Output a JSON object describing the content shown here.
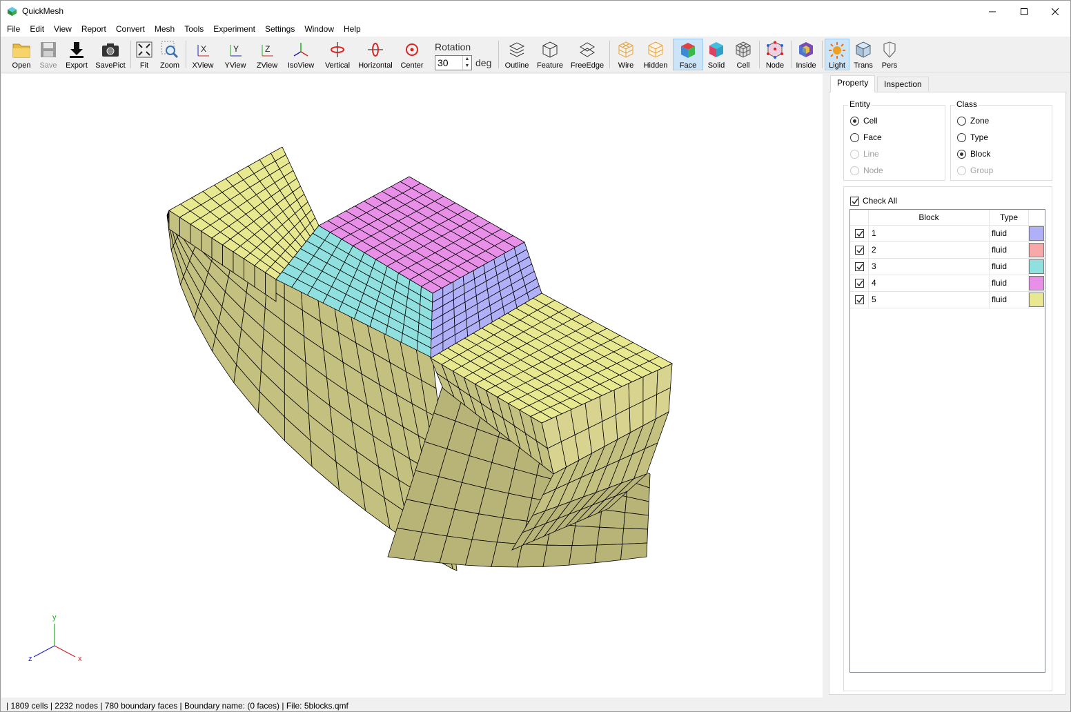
{
  "app": {
    "title": "QuickMesh"
  },
  "menu": [
    "File",
    "Edit",
    "View",
    "Report",
    "Convert",
    "Mesh",
    "Tools",
    "Experiment",
    "Settings",
    "Window",
    "Help"
  ],
  "toolbar": {
    "open": "Open",
    "save": "Save",
    "export": "Export",
    "savepict": "SavePict",
    "fit": "Fit",
    "zoom": "Zoom",
    "xview": "XView",
    "yview": "YView",
    "zview": "ZView",
    "isoview": "IsoView",
    "vertical": "Vertical",
    "horizontal": "Horizontal",
    "center": "Center",
    "rotation_label": "Rotation",
    "rotation_value": "30",
    "rotation_unit": "deg",
    "outline": "Outline",
    "feature": "Feature",
    "freeedge": "FreeEdge",
    "wire": "Wire",
    "hidden": "Hidden",
    "face": "Face",
    "solid": "Solid",
    "cell": "Cell",
    "node": "Node",
    "inside": "Inside",
    "light": "Light",
    "trans": "Trans",
    "pers": "Pers"
  },
  "axes": {
    "x": "x",
    "y": "y",
    "z": "z"
  },
  "panel": {
    "tabs": [
      "Property",
      "Inspection"
    ],
    "entity": {
      "title": "Entity",
      "options": [
        "Cell",
        "Face",
        "Line",
        "Node"
      ],
      "selected": "Cell"
    },
    "class": {
      "title": "Class",
      "options": [
        "Zone",
        "Type",
        "Block",
        "Group"
      ],
      "selected": "Block"
    },
    "check_all": "Check All",
    "table": {
      "headers": [
        "Block",
        "Type"
      ],
      "rows": [
        {
          "block": "1",
          "type": "fluid",
          "color": "#b0b0f8"
        },
        {
          "block": "2",
          "type": "fluid",
          "color": "#f8a8a8"
        },
        {
          "block": "3",
          "type": "fluid",
          "color": "#90e0e0"
        },
        {
          "block": "4",
          "type": "fluid",
          "color": "#e890e8"
        },
        {
          "block": "5",
          "type": "fluid",
          "color": "#e8e890"
        }
      ]
    }
  },
  "status": "| 1809 cells | 2232 nodes | 780 boundary faces |  Boundary name:  (0 faces) | File: 5blocks.qmf"
}
